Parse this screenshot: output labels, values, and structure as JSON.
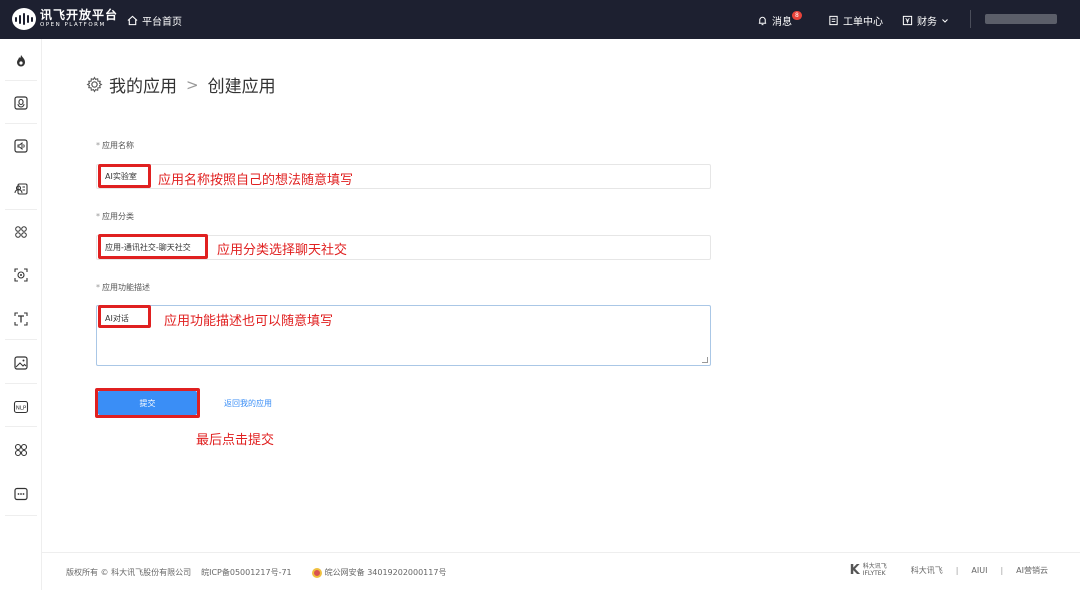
{
  "header": {
    "logo_main": "讯飞开放平台",
    "logo_sub": "OPEN PLATFORM",
    "home_label": "平台首页",
    "messages_label": "消息",
    "messages_badge": "8",
    "tickets_label": "工单中心",
    "finance_label": "财务",
    "icons": [
      "home-icon",
      "bell-icon",
      "document-icon",
      "finance-icon",
      "chevron-down-icon"
    ]
  },
  "sidebar": {
    "icons": [
      "flame-icon",
      "voice-box-icon",
      "speaker-icon",
      "person-card-icon",
      "face-scan-icon",
      "camera-scan-icon",
      "text-scan-icon",
      "image-icon",
      "nlp-icon",
      "apps-grid-icon",
      "more-icon"
    ]
  },
  "breadcrumb": {
    "parent": "我的应用",
    "separator": ">",
    "current": "创建应用"
  },
  "form": {
    "name_label": "应用名称",
    "name_value": "AI实验室",
    "category_label": "应用分类",
    "category_value": "应用-通讯社交-聊天社交",
    "description_label": "应用功能描述",
    "description_value": "AI对话",
    "required_mark": "*",
    "submit_label": "提交",
    "back_label": "返回我的应用"
  },
  "annotations": {
    "name_hint": "应用名称按照自己的想法随意填写",
    "category_hint": "应用分类选择聊天社交",
    "description_hint": "应用功能描述也可以随意填写",
    "submit_hint": "最后点击提交"
  },
  "footer": {
    "copyright": "版权所有 © 科大讯飞股份有限公司",
    "icp": "皖ICP备05001217号-71",
    "police": "皖公网安备 34019202000117号",
    "brand_mark": "K",
    "brand_cn": "科大讯飞",
    "brand_en": "IFLYTEK",
    "links": [
      "科大讯飞",
      "AIUI",
      "AI营销云"
    ],
    "link_sep": "|"
  },
  "colors": {
    "topbar": "#1d2030",
    "accent": "#3a8ef6",
    "annotation": "#e02020"
  }
}
